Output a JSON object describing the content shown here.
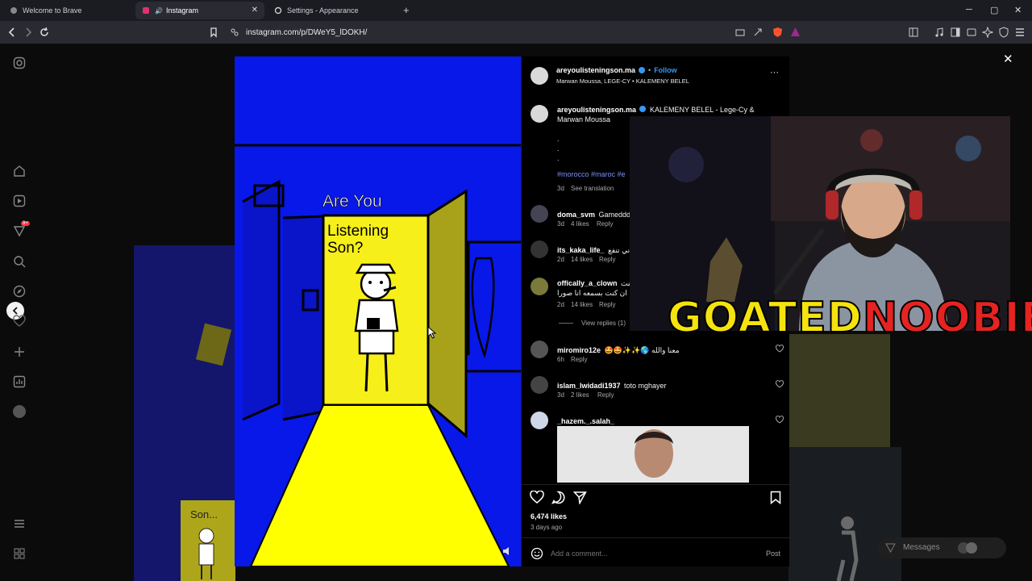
{
  "browser": {
    "tabs": [
      {
        "label": "Welcome to Brave",
        "active": false
      },
      {
        "label": "Instagram",
        "active": true
      },
      {
        "label": "Settings - Appearance",
        "active": false
      }
    ],
    "new_tab": "+",
    "close_tab": "✕",
    "url": "instagram.com/p/DWeY5_lDOKH/",
    "window_controls": [
      "─",
      "▢",
      "✕"
    ]
  },
  "sidebar": {
    "badge": "9+"
  },
  "media": {
    "drawing_text_1": "Are You",
    "drawing_text_2": "Listening",
    "drawing_text_3": "Son?",
    "background_thumb_text": "Son...",
    "colors": {
      "bg": "#0818e8",
      "door": "#f7ef1a",
      "floor": "#ffff00"
    }
  },
  "post": {
    "author": "areyoulisteningson.ma",
    "follow": "Follow",
    "dot": "•",
    "subtitle": "Marwan Moussa, LEGE-CY • KALEMENY BELEL",
    "more": "···",
    "caption_user": "areyoulisteningson.ma",
    "caption_text": "KALEMENY BELEL - Lege-Cy &",
    "caption_text2": "Marwan Moussa",
    "dots": ".",
    "hashtags": "#morocco #maroc #e",
    "caption_time": "3d",
    "see_translation": "See translation",
    "comments": [
      {
        "user": "doma_svm",
        "text": "Gameddd",
        "time": "3d",
        "likes": "4 likes",
        "reply": "Reply"
      },
      {
        "user": "its_kaka_life_",
        "text": "اني تنفع",
        "time": "2d",
        "likes": "14 likes",
        "reply": "Reply"
      },
      {
        "user": "offically_a_clown",
        "text": "كنت",
        "text2": "ان كنت بسمعه انا صورا",
        "time": "2d",
        "likes": "14 likes",
        "reply": "Reply",
        "view_replies": "View replies (1)"
      },
      {
        "user": "miromiro12e",
        "text": "🤩🤩✨✨🌎 معنا والله",
        "time": "6h",
        "likes": "",
        "reply": "Reply"
      },
      {
        "user": "islam_lwidadi1937",
        "text": "toto mghayer",
        "time": "3d",
        "likes": "2 likes",
        "reply": "Reply"
      },
      {
        "user": "_hazem._.salah_",
        "text": "",
        "time": "",
        "likes": "",
        "reply": ""
      }
    ],
    "likes_count": "6,474 likes",
    "posted": "3 days ago",
    "add_comment_placeholder": "Add a comment...",
    "post_button": "Post"
  },
  "overlay": {
    "word1": "GOATED",
    "word2": "NOOBIE"
  },
  "messages": {
    "label": "Messages"
  },
  "close": "✕"
}
